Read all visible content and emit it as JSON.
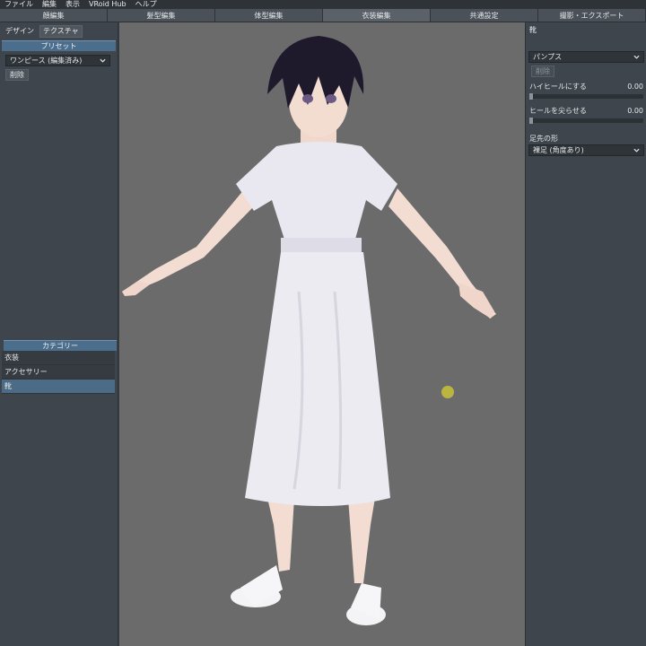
{
  "menu": [
    "ファイル",
    "編集",
    "表示",
    "VRoid Hub",
    "ヘルプ"
  ],
  "tabs": [
    {
      "label": "顔編集",
      "active": false
    },
    {
      "label": "髪型編集",
      "active": false
    },
    {
      "label": "体型編集",
      "active": false
    },
    {
      "label": "衣装編集",
      "active": true
    },
    {
      "label": "共通設定",
      "active": false
    },
    {
      "label": "撮影・エクスポート",
      "active": false
    }
  ],
  "left": {
    "subtabs": [
      "デザイン",
      "テクスチャ"
    ],
    "preset_header": "プリセット",
    "preset_value": "ワンピース (編集済み)",
    "delete_label": "削除",
    "category_header": "カテゴリー",
    "categories": [
      "衣装",
      "アクセサリー",
      "靴"
    ],
    "selected_category": "靴"
  },
  "right": {
    "title": "靴",
    "shoe_preset": "パンプス",
    "delete_label": "削除",
    "high_heel_label": "ハイヒールにする",
    "high_heel_value": "0.00",
    "heel_sharpen_label": "ヒールを尖らせる",
    "heel_sharpen_value": "0.00",
    "toe_shape_label": "足先の形",
    "toe_shape_value": "裸足 (角度あり)"
  },
  "colors": {
    "accent": "#4a6e8c",
    "viewport_bg": "#6b6b6b",
    "panel_bg": "#3f454c"
  }
}
